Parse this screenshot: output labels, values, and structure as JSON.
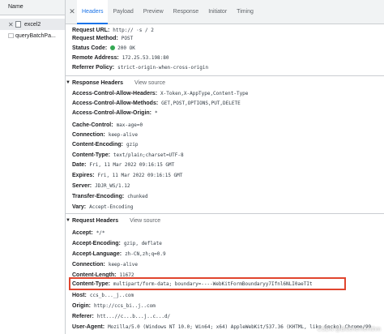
{
  "request_list": {
    "header": "Name",
    "items": [
      {
        "name": "excel2",
        "selected": true
      },
      {
        "name": "queryBatchPa...",
        "selected": false
      }
    ]
  },
  "tabs": {
    "close_icon": "close-icon",
    "items": [
      "Headers",
      "Payload",
      "Preview",
      "Response",
      "Initiator",
      "Timing"
    ],
    "active": "Headers"
  },
  "general": {
    "rows": [
      {
        "name": "Request URL:",
        "value": "http://  ·s      /              2"
      },
      {
        "name": "Request Method:",
        "value": "POST"
      },
      {
        "name": "Status Code:",
        "value": "200 OK",
        "status_color": "#34a853"
      },
      {
        "name": "Remote Address:",
        "value": "172.25.53.198:80"
      },
      {
        "name": "Referrer Policy:",
        "value": "strict-origin-when-cross-origin"
      }
    ]
  },
  "response_headers": {
    "title": "Response Headers",
    "view_source": "View source",
    "rows": [
      {
        "name": "Access-Control-Allow-Headers:",
        "value": "X-Token,X-AppType,Content-Type"
      },
      {
        "name": "Access-Control-Allow-Methods:",
        "value": "GET,POST,OPTIONS,PUT,DELETE"
      },
      {
        "name": "Access-Control-Allow-Origin:",
        "value": "*"
      },
      {
        "name": "Cache-Control:",
        "value": "max-age=0"
      },
      {
        "name": "Connection:",
        "value": "keep-alive"
      },
      {
        "name": "Content-Encoding:",
        "value": "gzip"
      },
      {
        "name": "Content-Type:",
        "value": "text/plain;charset=UTF-8"
      },
      {
        "name": "Date:",
        "value": "Fri, 11 Mar 2022 09:16:15 GMT"
      },
      {
        "name": "Expires:",
        "value": "Fri, 11 Mar 2022 09:16:15 GMT"
      },
      {
        "name": "Server:",
        "value": "JDJR_WS/1.12"
      },
      {
        "name": "Transfer-Encoding:",
        "value": "chunked"
      },
      {
        "name": "Vary:",
        "value": "Accept-Encoding"
      }
    ]
  },
  "request_headers": {
    "title": "Request Headers",
    "view_source": "View source",
    "rows": [
      {
        "name": "Accept:",
        "value": "*/*"
      },
      {
        "name": "Accept-Encoding:",
        "value": "gzip, deflate"
      },
      {
        "name": "Accept-Language:",
        "value": "zh-CN,zh;q=0.9"
      },
      {
        "name": "Connection:",
        "value": "keep-alive"
      },
      {
        "name": "Content-Length:",
        "value": "11672"
      },
      {
        "name": "Content-Type:",
        "value": "multipart/form-data; boundary=----WebKitFormBoundaryy7Ifnl6NLI0aeTIt",
        "highlighted": true
      },
      {
        "name": "Host:",
        "value": "ccs_b..._j..com"
      },
      {
        "name": "Origin:",
        "value": "http://ccs_bi..j..com"
      },
      {
        "name": "Referer:",
        "value": "htt...//c...b...j..c...d/"
      },
      {
        "name": "User-Agent:",
        "value": "Mozilla/5.0 (Windows NT 10.0; Win64; x64) AppleWebKit/537.36 (KHTML, like Gecko) Chrome/99"
      }
    ]
  },
  "highlight_color": "#e0452e",
  "watermark": "CSDN @Blueherhemthm"
}
